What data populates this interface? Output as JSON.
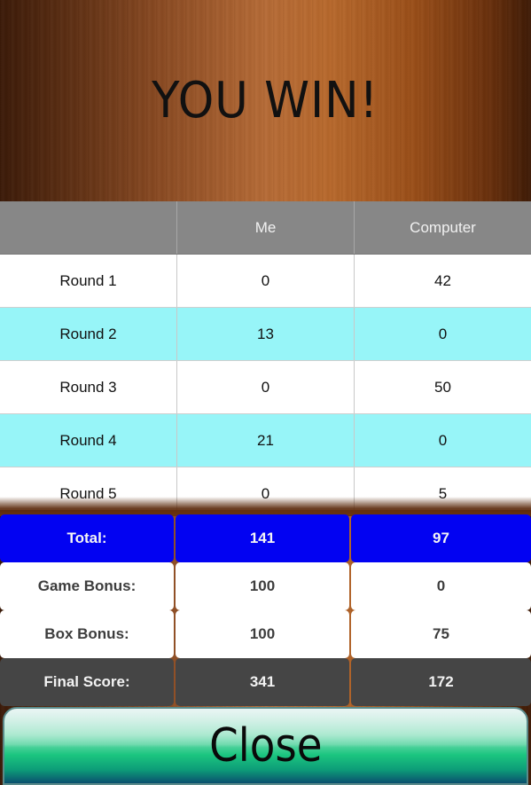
{
  "header": {
    "title": "YOU WIN!"
  },
  "table": {
    "columns": [
      "",
      "Me",
      "Computer"
    ],
    "rounds": [
      {
        "label": "Round 1",
        "me": "0",
        "computer": "42"
      },
      {
        "label": "Round 2",
        "me": "13",
        "computer": "0"
      },
      {
        "label": "Round 3",
        "me": "0",
        "computer": "50"
      },
      {
        "label": "Round 4",
        "me": "21",
        "computer": "0"
      },
      {
        "label": "Round 5",
        "me": "0",
        "computer": "5"
      }
    ]
  },
  "summary": {
    "total": {
      "label": "Total:",
      "me": "141",
      "computer": "97"
    },
    "game_bonus": {
      "label": "Game Bonus:",
      "me": "100",
      "computer": "0"
    },
    "box_bonus": {
      "label": "Box Bonus:",
      "me": "100",
      "computer": "75"
    },
    "final_score": {
      "label": "Final Score:",
      "me": "341",
      "computer": "172"
    }
  },
  "colors": {
    "total_row": "#0202f2",
    "final_row": "#454545",
    "alt_row": "#97f5f8",
    "header_row": "#878787"
  },
  "close_button": {
    "label": "Close"
  }
}
